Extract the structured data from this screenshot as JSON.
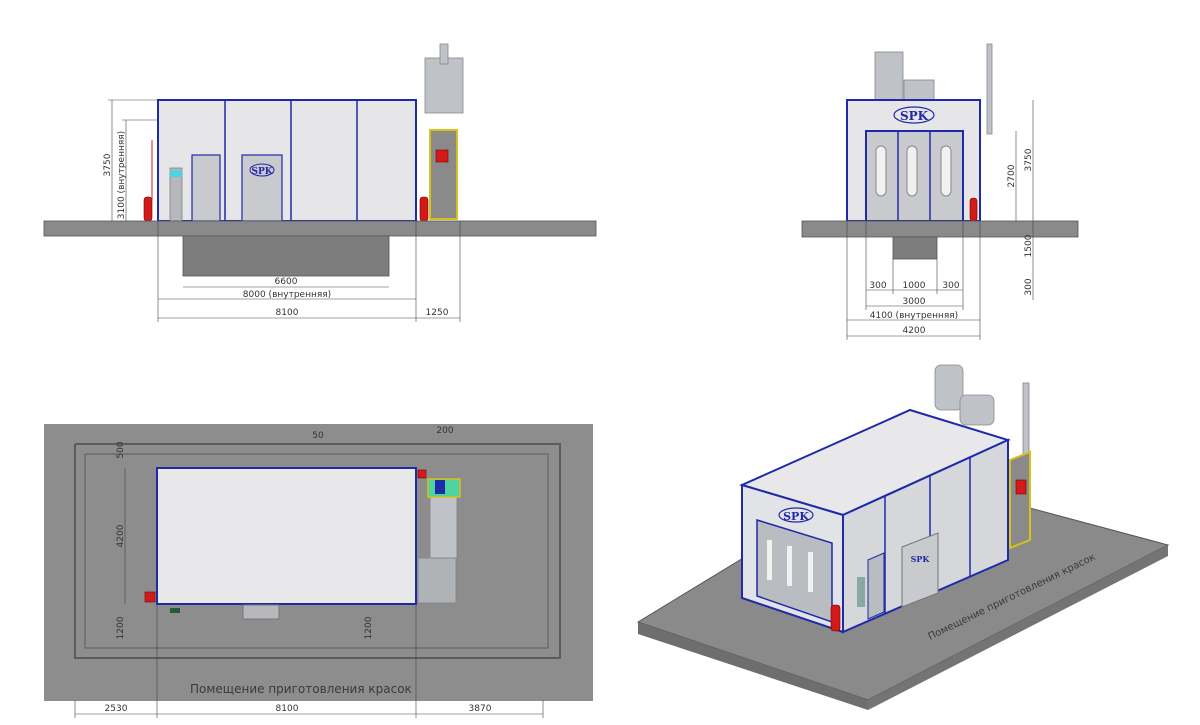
{
  "brand": {
    "logo_text": "SPK"
  },
  "colors": {
    "frame": "#1f2aa8",
    "floor": "#8a8a8a",
    "wall": "#e6e6e8",
    "accent": "#d21a1a",
    "highlight": "#d6c21a"
  },
  "side_view": {
    "height_total": "3750",
    "height_inner": "3100 (внутренняя)",
    "pit_length": "6600",
    "inner_length": "8000 (внутренняя)",
    "outer_length": "8100",
    "unit_length": "1250"
  },
  "front_view": {
    "height_total": "3750",
    "door_height": "2700",
    "pit_depth": "1500",
    "floor_depth": "300",
    "pit_sub": [
      "300",
      "1000",
      "300"
    ],
    "pit_width": "3000",
    "inner_width": "4100 (внутренняя)",
    "outer_width": "4200"
  },
  "plan_view": {
    "top_left": "500",
    "top_mid": "50",
    "top_right": "200",
    "left_width": "4200",
    "bottom_left": "1200",
    "bottom_right": "1200",
    "bottom_dims": [
      "2530",
      "8100",
      "3870"
    ],
    "room_label": "Помещение приготовления красок"
  },
  "iso_view": {
    "room_label": "Помещение приготовления красок"
  }
}
